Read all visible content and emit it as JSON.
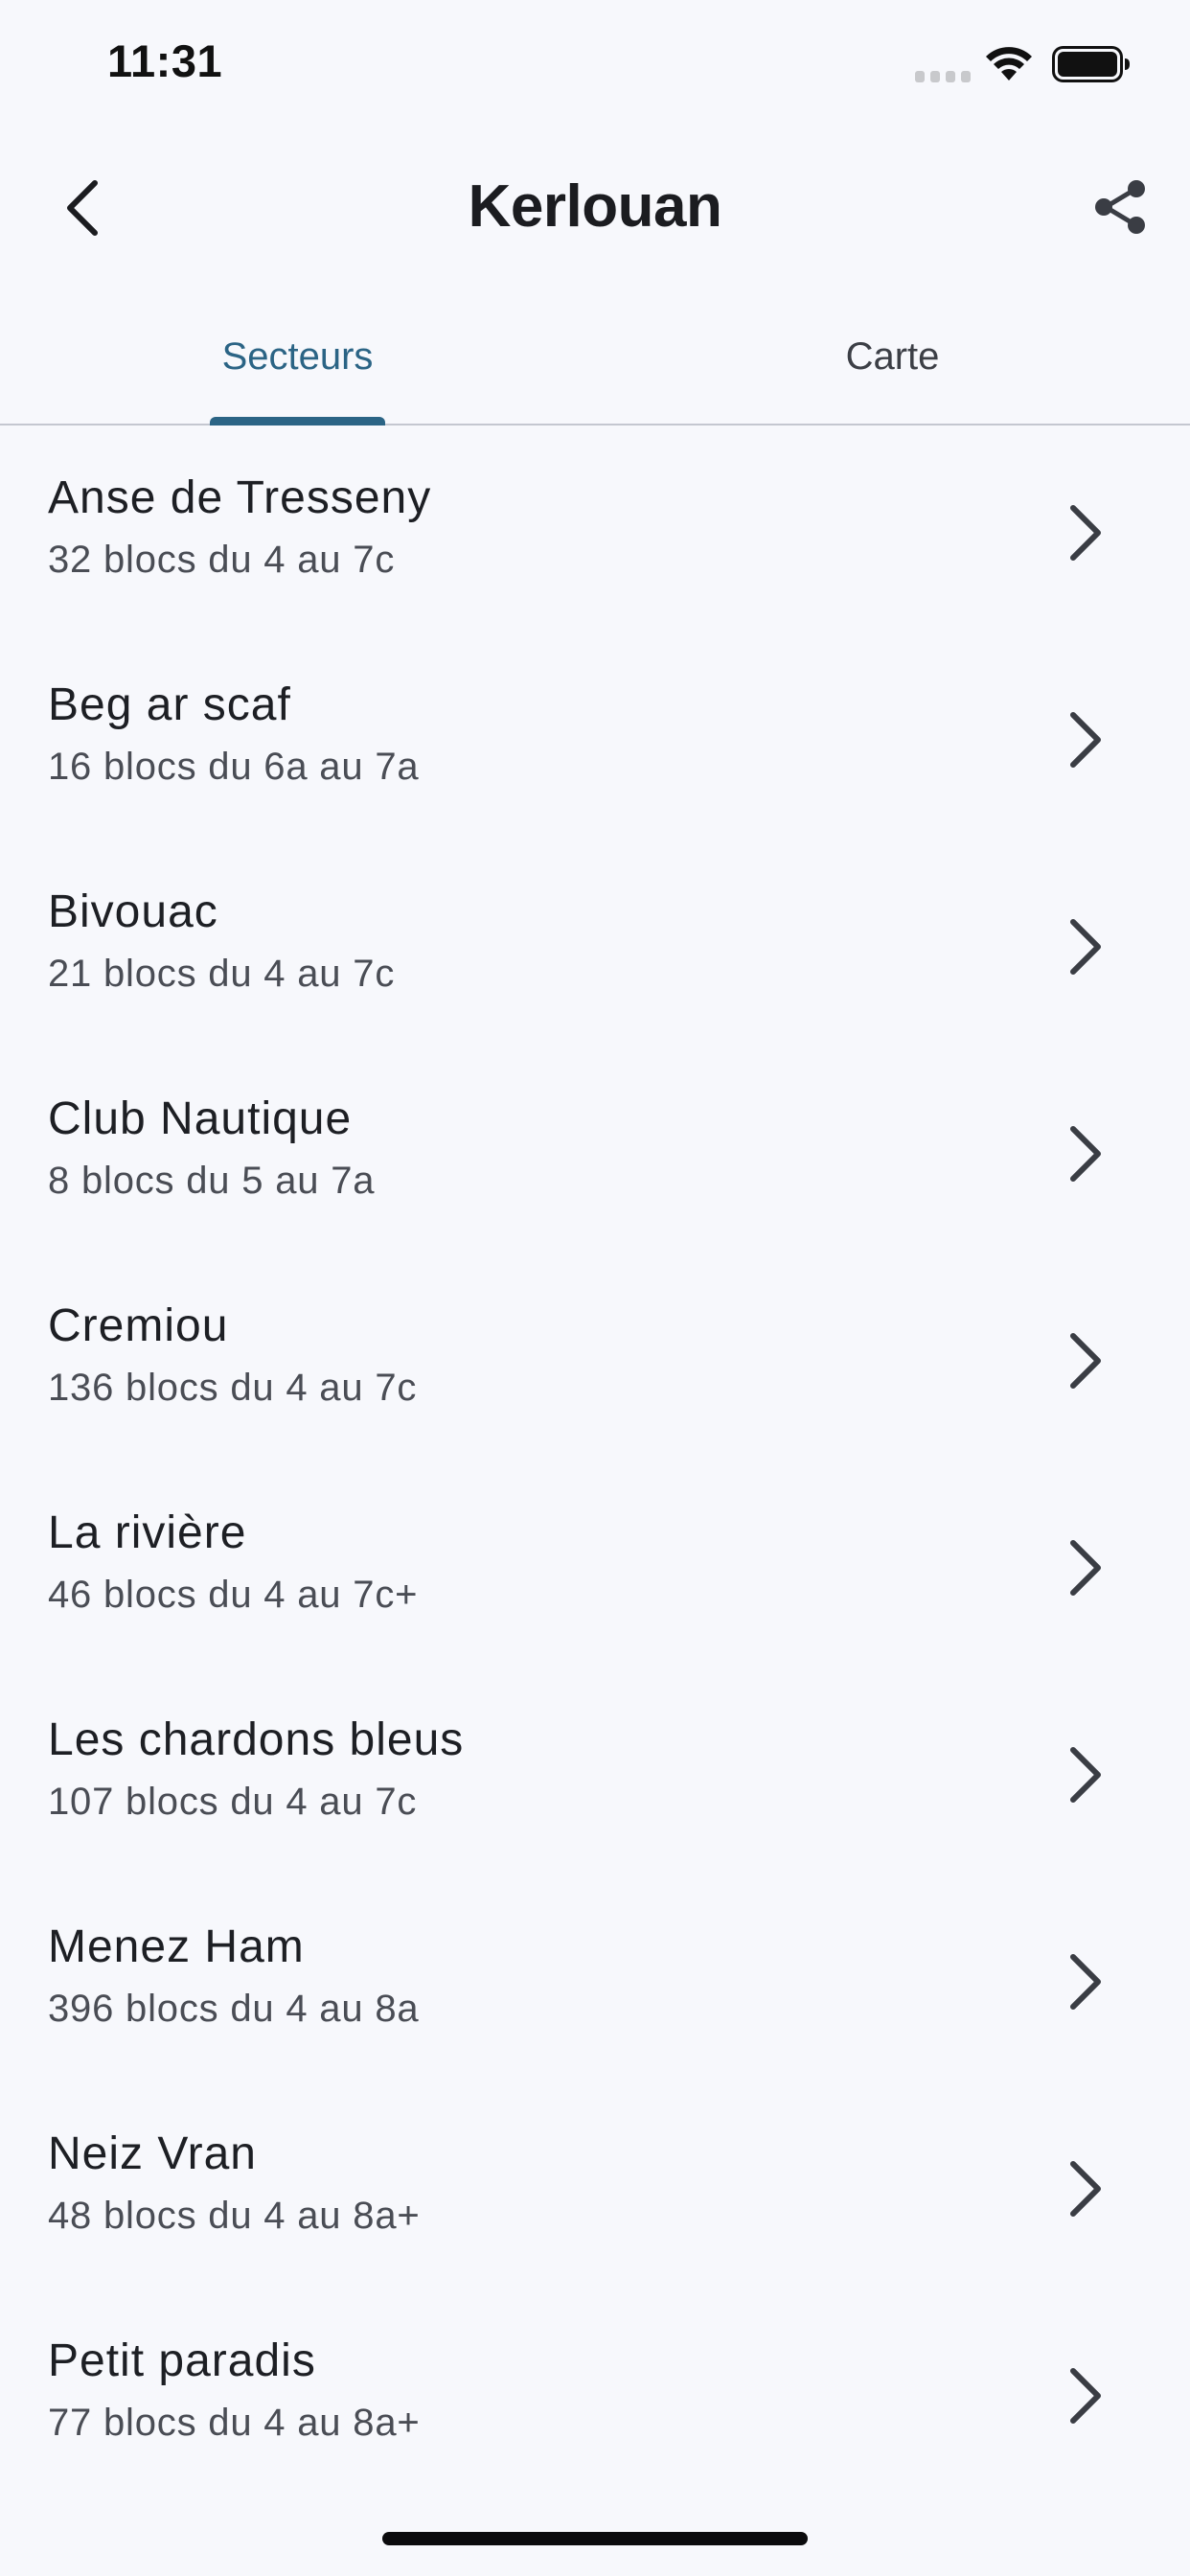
{
  "status_bar": {
    "time": "11:31",
    "icons": [
      "signal-icon",
      "wifi-icon",
      "battery-icon"
    ]
  },
  "header": {
    "title": "Kerlouan",
    "back_icon": "chevron-left-icon",
    "share_icon": "share-icon"
  },
  "tabs": [
    {
      "label": "Secteurs",
      "active": true
    },
    {
      "label": "Carte",
      "active": false
    }
  ],
  "colors": {
    "accent": "#2b6485",
    "background": "#f7f8fc",
    "text_primary": "#1d1f24",
    "text_secondary": "#4a4d55"
  },
  "sectors": [
    {
      "name": "Anse de Tresseny",
      "info": "32 blocs du 4 au 7c"
    },
    {
      "name": "Beg ar scaf",
      "info": "16 blocs du 6a au 7a"
    },
    {
      "name": "Bivouac",
      "info": "21 blocs du 4 au 7c"
    },
    {
      "name": "Club Nautique",
      "info": "8 blocs du 5 au 7a"
    },
    {
      "name": "Cremiou",
      "info": "136 blocs du 4 au 7c"
    },
    {
      "name": "La rivière",
      "info": "46 blocs du 4 au 7c+"
    },
    {
      "name": "Les chardons bleus",
      "info": "107 blocs du 4 au 7c"
    },
    {
      "name": "Menez Ham",
      "info": "396 blocs du 4 au 8a"
    },
    {
      "name": "Neiz Vran",
      "info": "48 blocs du 4 au 8a+"
    },
    {
      "name": "Petit paradis",
      "info": "77 blocs du 4 au 8a+"
    }
  ]
}
